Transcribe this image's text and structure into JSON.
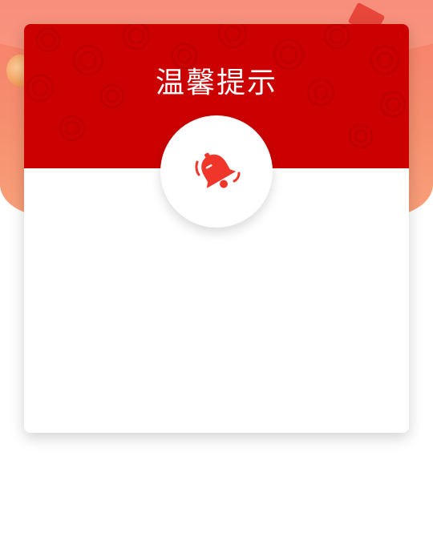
{
  "dialog": {
    "title": "温馨提示",
    "body_text": ""
  },
  "colors": {
    "header_red": "#cc0000",
    "icon_red": "#f0362a",
    "banner_coral": "#f77f6a"
  },
  "icons": {
    "dialog_icon": "bell-ringing-icon"
  }
}
